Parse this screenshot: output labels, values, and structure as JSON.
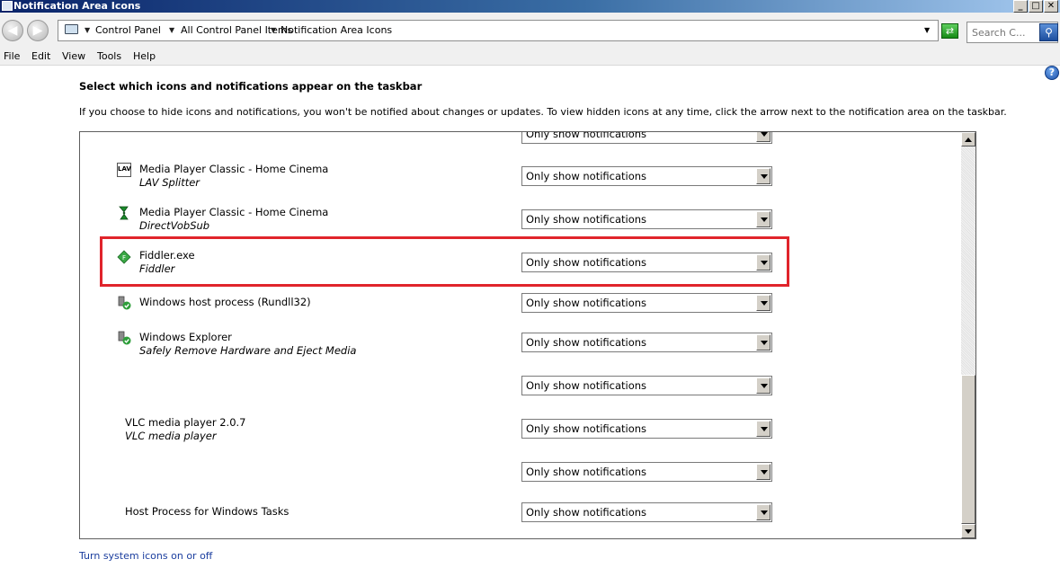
{
  "window": {
    "title": "Notification Area Icons"
  },
  "address_bar": {
    "crumbs": [
      "Control Panel",
      "All Control Panel Items",
      "Notification Area Icons"
    ],
    "search_placeholder": "Search C..."
  },
  "menu": [
    "File",
    "Edit",
    "View",
    "Tools",
    "Help"
  ],
  "heading": "Select which icons and notifications appear on the taskbar",
  "description": "If you choose to hide icons and notifications, you won't be notified about changes or updates. To view hidden icons at any time, click the arrow next to the notification area on the taskbar.",
  "items": [
    {
      "name": "",
      "sub": "",
      "behavior": "Only show notifications"
    },
    {
      "name": "Media Player Classic - Home Cinema",
      "sub": "LAV Splitter",
      "behavior": "Only show notifications",
      "icon": "lav-splitter-icon"
    },
    {
      "name": "Media Player Classic - Home Cinema",
      "sub": "DirectVobSub",
      "behavior": "Only show notifications",
      "icon": "directvobsub-icon"
    },
    {
      "name": "Fiddler.exe",
      "sub": "Fiddler",
      "behavior": "Only show notifications",
      "icon": "fiddler-icon"
    },
    {
      "name": "Windows host process (Rundll32)",
      "sub": "",
      "behavior": "Only show notifications",
      "icon": "usb-device-icon"
    },
    {
      "name": "Windows Explorer",
      "sub": "Safely Remove Hardware and Eject Media",
      "behavior": "Only show notifications",
      "icon": "usb-device-icon"
    },
    {
      "name": "",
      "sub": "",
      "behavior": "Only show notifications"
    },
    {
      "name": "VLC media player 2.0.7",
      "sub": "VLC media player",
      "behavior": "Only show notifications"
    },
    {
      "name": "",
      "sub": "",
      "behavior": "Only show notifications"
    },
    {
      "name": "Host Process for Windows Tasks",
      "sub": "",
      "behavior": "Only show notifications"
    }
  ],
  "links": {
    "system_icons": "Turn system icons on or off"
  },
  "colors": {
    "highlight": "#e0242b",
    "link": "#1a3d9e"
  }
}
